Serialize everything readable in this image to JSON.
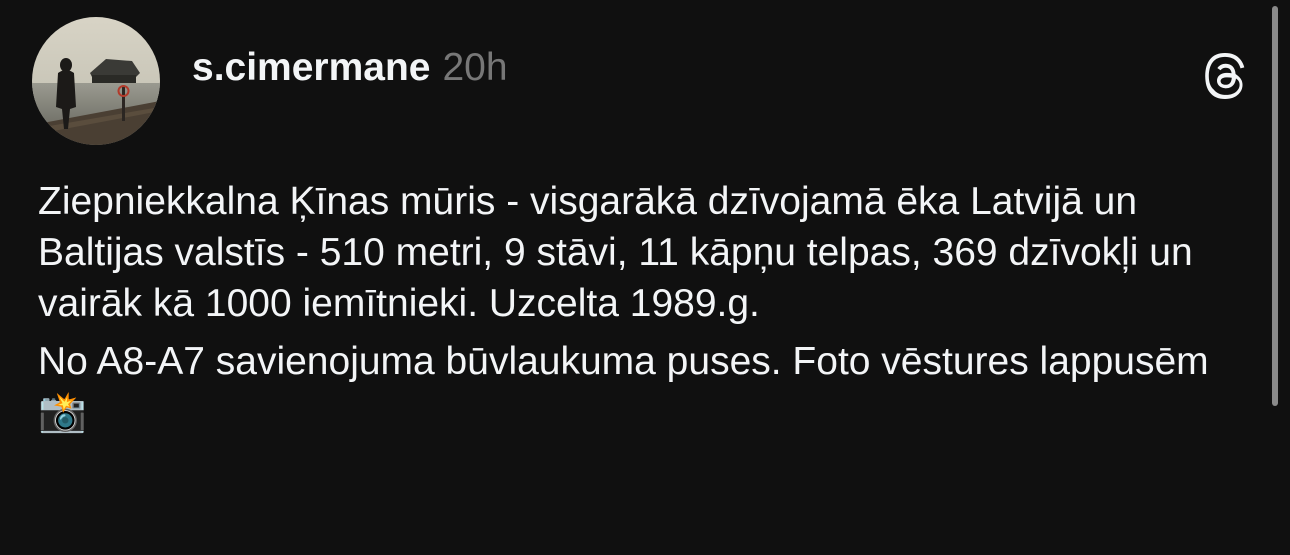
{
  "post": {
    "author": {
      "username": "s.cimermane",
      "avatar_description": "profile photo"
    },
    "timestamp": "20h",
    "app_icon": "threads-logo-icon",
    "text_paragraphs": [
      "Ziepniekkalna Ķīnas mūris - visgarākā dzīvojamā ēka Latvijā un Baltijas valstīs - 510 metri, 9 stāvi, 11 kāpņu telpas, 369 dzīvokļi un vairāk kā 1000 iemītnieki. Uzcelta 1989.g.",
      "No A8-A7 savienojuma būvlaukuma puses. Foto vēstures lappusēm 📸"
    ]
  },
  "colors": {
    "background": "#101010",
    "primary_text": "#f3f5f7",
    "secondary_text": "#777777",
    "scrollbar": "#8a8a8a"
  }
}
